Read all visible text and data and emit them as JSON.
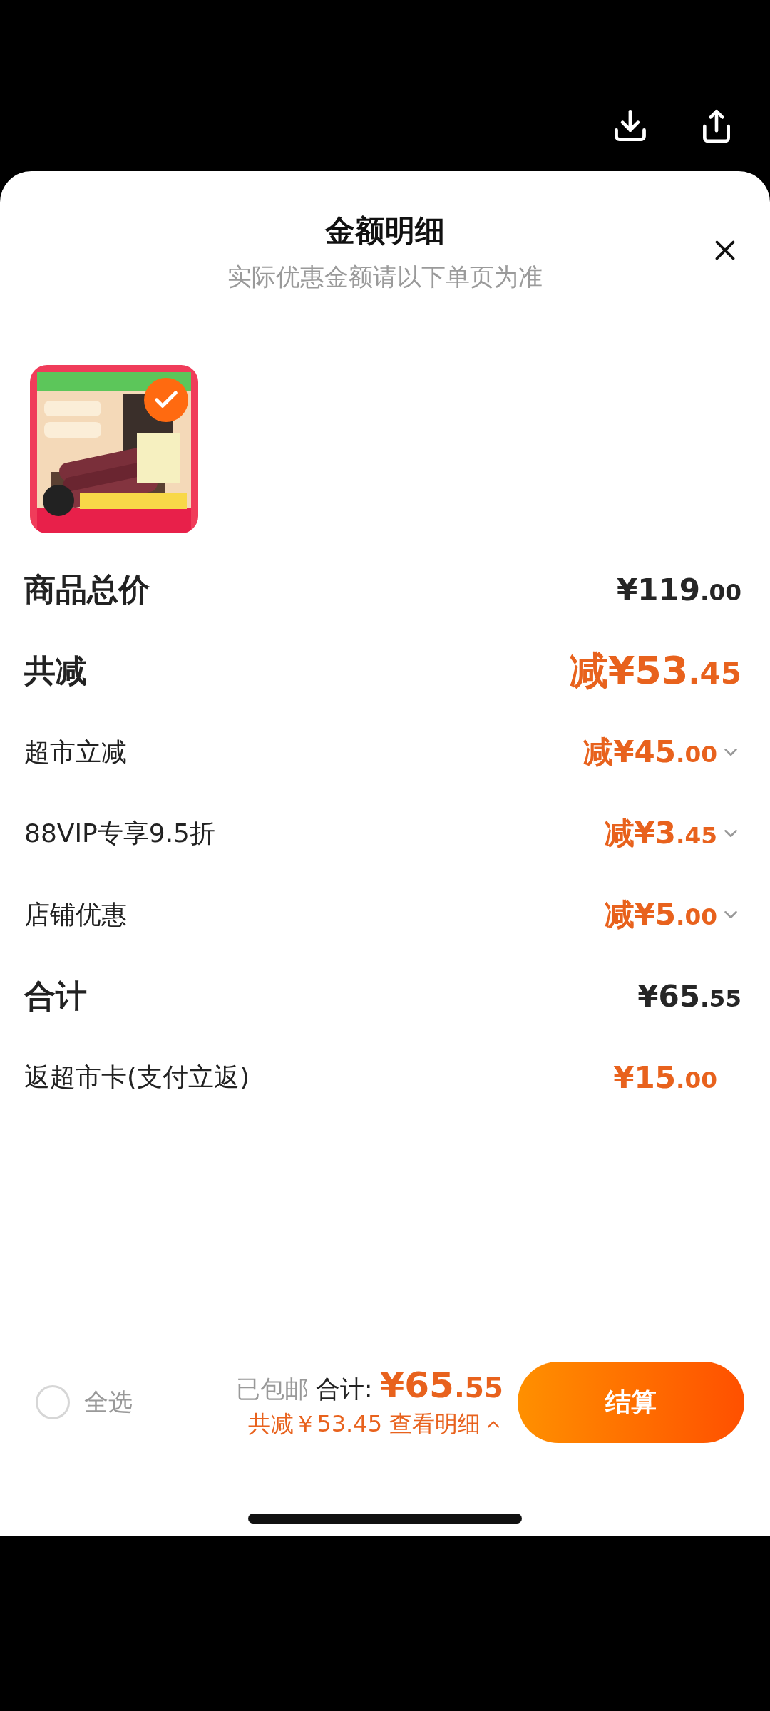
{
  "sheet": {
    "title": "金额明细",
    "subtitle": "实际优惠金额请以下单页为准"
  },
  "product": {
    "kind": "picture",
    "selected": true
  },
  "rows": [
    {
      "kind": "header",
      "label": "商品总价",
      "amount": "¥119",
      "cents": ".00",
      "color": "#262626",
      "expandable": false
    },
    {
      "kind": "header",
      "label": "共减",
      "amount": "减¥53",
      "cents": ".45",
      "color": "#e8621d",
      "expandable": false
    },
    {
      "kind": "detail",
      "label": "超市立减",
      "amount": "减¥45",
      "cents": ".00",
      "color": "#e8621d",
      "expandable": true
    },
    {
      "kind": "detail",
      "label": "88VIP专享9.5折",
      "amount": "减¥3",
      "cents": ".45",
      "color": "#e8621d",
      "expandable": true
    },
    {
      "kind": "detail",
      "label": "店铺优惠",
      "amount": "减¥5",
      "cents": ".00",
      "color": "#e8621d",
      "expandable": true
    },
    {
      "kind": "header",
      "label": "合计",
      "amount": "¥65",
      "cents": ".55",
      "color": "#262626",
      "expandable": false
    },
    {
      "kind": "detail",
      "label": "返超市卡(支付立返)",
      "amount": "¥15",
      "cents": ".00",
      "color": "#e8621d",
      "expandable": false
    }
  ],
  "footer": {
    "select_all": {
      "label": "全选",
      "checked": false
    },
    "shipping": "已包邮",
    "total_label": "合计:",
    "total_amount": "¥65",
    "total_cents": ".55",
    "savings": "共减￥53.45",
    "details_link": "查看明细",
    "checkout": "结算"
  }
}
